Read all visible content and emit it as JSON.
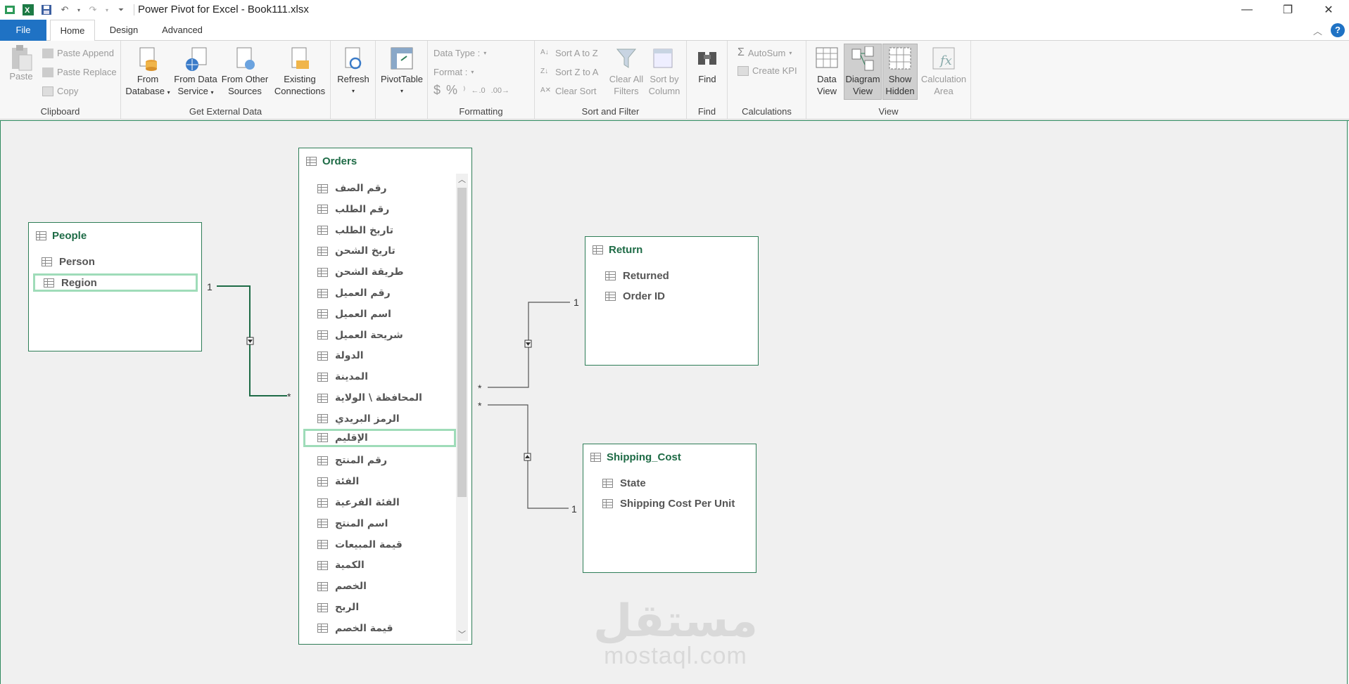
{
  "window": {
    "title": "Power Pivot for Excel - Book111.xlsx",
    "controls": [
      "—",
      "❐",
      "✕"
    ]
  },
  "tabs": {
    "file": "File",
    "home": "Home",
    "design": "Design",
    "advanced": "Advanced"
  },
  "ribbon": {
    "clipboard": {
      "label": "Clipboard",
      "paste": "Paste",
      "paste_append": "Paste Append",
      "paste_replace": "Paste Replace",
      "copy": "Copy"
    },
    "external": {
      "label": "Get External Data",
      "from_database_1": "From",
      "from_database_2": "Database",
      "from_data_service_1": "From Data",
      "from_data_service_2": "Service",
      "from_other_sources_1": "From Other",
      "from_other_sources_2": "Sources",
      "existing_connections_1": "Existing",
      "existing_connections_2": "Connections"
    },
    "refresh": "Refresh",
    "pivottable": "PivotTable",
    "formatting": {
      "label": "Formatting",
      "data_type": "Data Type :",
      "format": "Format :"
    },
    "sort_filter": {
      "label": "Sort and Filter",
      "sort_az": "Sort A to Z",
      "sort_za": "Sort Z to A",
      "clear_sort": "Clear Sort",
      "clear_all_filters_1": "Clear All",
      "clear_all_filters_2": "Filters",
      "sort_by_column_1": "Sort by",
      "sort_by_column_2": "Column"
    },
    "find": {
      "label": "Find",
      "find": "Find"
    },
    "calculations": {
      "label": "Calculations",
      "autosum": "AutoSum",
      "create_kpi": "Create KPI"
    },
    "view": {
      "label": "View",
      "data_view_1": "Data",
      "data_view_2": "View",
      "diagram_view_1": "Diagram",
      "diagram_view_2": "View",
      "show_hidden_1": "Show",
      "show_hidden_2": "Hidden",
      "calc_area_1": "Calculation",
      "calc_area_2": "Area"
    }
  },
  "diagram": {
    "people": {
      "name": "People",
      "columns": [
        "Person",
        "Region"
      ]
    },
    "orders": {
      "name": "Orders",
      "columns": [
        "رقم الصف",
        "رقم الطلب",
        "تاريخ الطلب",
        "تاريخ الشحن",
        "طريقة الشحن",
        "رقم العميل",
        "اسم العميل",
        "شريحة العميل",
        "الدولة",
        "المدينة",
        "المحافظة \\ الولاية",
        "الرمز البريدي",
        "الإقليم",
        "رقم المنتج",
        "الفئة",
        "الفئة الفرعية",
        "اسم المنتج",
        "قيمة المبيعات",
        "الكمية",
        "الخصم",
        "الربح",
        "قيمة الخصم"
      ]
    },
    "return": {
      "name": "Return",
      "columns": [
        "Returned",
        "Order ID"
      ]
    },
    "shipping": {
      "name": "Shipping_Cost",
      "columns": [
        "State",
        "Shipping Cost Per Unit"
      ]
    },
    "relationships": {
      "people_one": "1",
      "people_many": "*",
      "return_one": "1",
      "return_many": "*",
      "ship_one": "1",
      "ship_many": "*"
    }
  },
  "watermark": {
    "arabic": "مستقل",
    "latin": "mostaql.com"
  }
}
